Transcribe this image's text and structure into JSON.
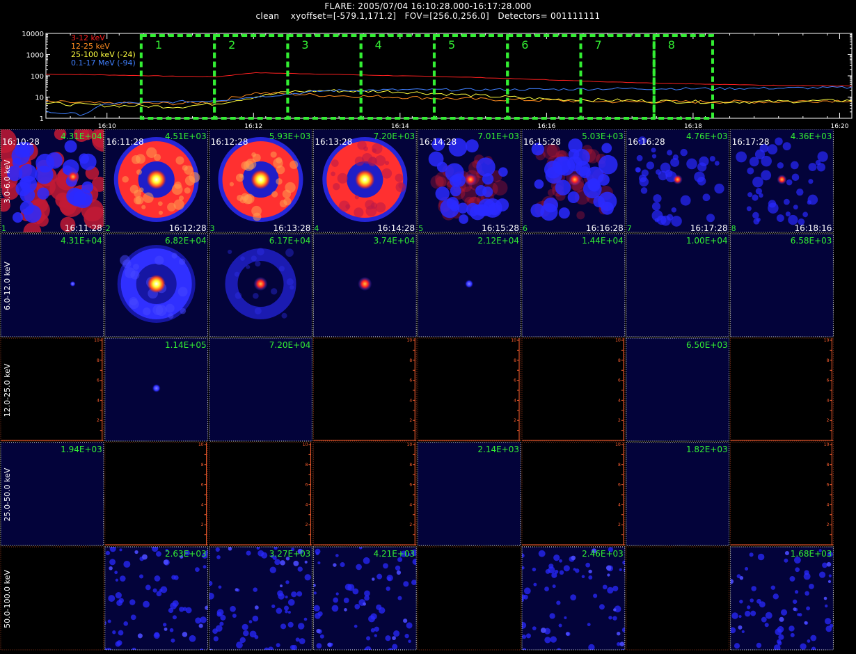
{
  "header": {
    "line1": "FLARE: 2005/07/04  16:10:28.000-16:17:28.000",
    "line2": "clean    xyoffset=[-579.1,171.2]   FOV=[256.0,256.0]   Detectors= 001111111"
  },
  "chart_data": [
    {
      "type": "line",
      "yscale": "log",
      "ylim": [
        1,
        10000
      ],
      "yticks": [
        "1",
        "10",
        "100",
        "1000",
        "10000"
      ],
      "xlim": [
        "16:09:10",
        "16:20:10"
      ],
      "xticks": [
        "16:10",
        "16:12",
        "16:14",
        "16:16",
        "16:18",
        "16:20"
      ],
      "legend_position": "top-left",
      "series": [
        {
          "name": "3-12 keV",
          "color": "#ff2020",
          "x": [
            "16:09:10",
            "16:10:00",
            "16:11:00",
            "16:11:30",
            "16:12:00",
            "16:13:00",
            "16:14:00",
            "16:15:00",
            "16:16:00",
            "16:17:00",
            "16:18:00",
            "16:19:00",
            "16:20:10"
          ],
          "values": [
            120,
            110,
            95,
            90,
            140,
            120,
            100,
            85,
            65,
            50,
            42,
            36,
            33
          ]
        },
        {
          "name": "12-25 keV",
          "color": "#ff8c20",
          "x": [
            "16:09:10",
            "16:10:00",
            "16:11:00",
            "16:11:30",
            "16:12:00",
            "16:12:30",
            "16:13:00",
            "16:14:00",
            "16:15:00",
            "16:16:00",
            "16:17:00",
            "16:18:00",
            "16:19:00",
            "16:20:10"
          ],
          "values": [
            6,
            5,
            5,
            6,
            16,
            14,
            12,
            10,
            8,
            7,
            6,
            6,
            6,
            7
          ]
        },
        {
          "name": "25-100 keV (-24)",
          "color": "#ffff40",
          "x": [
            "16:09:10",
            "16:10:00",
            "16:11:00",
            "16:11:30",
            "16:12:00",
            "16:12:30",
            "16:13:00",
            "16:14:00",
            "16:15:00",
            "16:16:00",
            "16:17:00",
            "16:18:00",
            "16:19:00",
            "16:20:10"
          ],
          "values": [
            5,
            4,
            3.5,
            5,
            10,
            18,
            20,
            18,
            12,
            8,
            7,
            6,
            6,
            7
          ]
        },
        {
          "name": "0.1-17 MeV (-94)",
          "color": "#4080ff",
          "x": [
            "16:09:10",
            "16:09:40",
            "16:10:00",
            "16:11:00",
            "16:11:30",
            "16:12:00",
            "16:13:00",
            "16:14:00",
            "16:15:00",
            "16:16:00",
            "16:17:00",
            "16:18:00",
            "16:19:00",
            "16:20:10"
          ],
          "values": [
            2,
            1.5,
            5,
            6,
            7,
            10,
            20,
            22,
            22,
            23,
            25,
            25,
            26,
            28
          ]
        }
      ],
      "intervals": {
        "color": "#33ee33",
        "labels": [
          "1",
          "2",
          "3",
          "4",
          "5",
          "6",
          "7",
          "8"
        ],
        "bounds": [
          "16:10:28",
          "16:11:28",
          "16:12:28",
          "16:13:28",
          "16:14:28",
          "16:15:28",
          "16:16:28",
          "16:17:28",
          "16:18:16"
        ]
      }
    },
    {
      "type": "heatmap",
      "description_rows": "energy bands",
      "row_labels": [
        "3.0-6.0 keV",
        "6.0-12.0 keV",
        "12.0-25.0 keV",
        "25.0-50.0 keV",
        "50.0-100.0 keV"
      ],
      "col_count": 8,
      "first_row_start_times": [
        "16:10:28",
        "16:11:28",
        "16:12:28",
        "16:13:28",
        "16:14:28",
        "16:15:28",
        "16:16:28",
        "16:17:28"
      ],
      "first_row_end_times": [
        "16:11:28",
        "16:12:28",
        "16:13:28",
        "16:14:28",
        "16:15:28",
        "16:16:28",
        "16:17:28",
        "16:18:16"
      ],
      "first_row_index_labels": [
        "1",
        "2",
        "3",
        "4",
        "5",
        "6",
        "7",
        "8"
      ],
      "cell_max": [
        [
          "4.31E+04",
          "4.51E+03",
          "5.93E+03",
          "7.20E+03",
          "7.01E+03",
          "5.03E+03",
          "4.76E+03",
          "4.36E+03"
        ],
        [
          "4.31E+04",
          "6.82E+04",
          "6.17E+04",
          "3.74E+04",
          "2.12E+04",
          "1.44E+04",
          "1.00E+04",
          "6.58E+03"
        ],
        [
          "",
          "1.14E+05",
          "7.20E+04",
          "",
          "",
          "",
          "6.50E+03",
          ""
        ],
        [
          "1.94E+03",
          "",
          "",
          "",
          "2.14E+03",
          "",
          "1.82E+03",
          ""
        ],
        [
          "",
          "2.63E+03",
          "3.27E+03",
          "4.21E+03",
          "",
          "2.46E+03",
          "",
          "1.68E+03"
        ]
      ],
      "cell_kind": [
        [
          "patchy",
          "ring",
          "ring",
          "ring-patchy",
          "patchy",
          "patchy",
          "faint",
          "faint"
        ],
        [
          "dot",
          "ring-blue",
          "ring-faint",
          "dot-red",
          "dot-tiny",
          "empty",
          "empty",
          "empty"
        ],
        [
          "black-axes",
          "dot-blue",
          "empty",
          "black-axes",
          "black-axes",
          "black-axes",
          "empty",
          "black-axes"
        ],
        [
          "empty",
          "black-axes",
          "black-axes",
          "black-axes",
          "empty",
          "black-axes",
          "empty",
          "black-axes"
        ],
        [
          "black",
          "noise",
          "noise",
          "noise",
          "black",
          "noise",
          "black",
          "noise"
        ]
      ],
      "empty_axis_ticks": [
        "2",
        "4",
        "6",
        "8",
        "10"
      ],
      "colors": {
        "label": "#33ee33",
        "axis": "#ff6030",
        "frame": "#ffffff",
        "bg": "#03033a"
      }
    }
  ]
}
